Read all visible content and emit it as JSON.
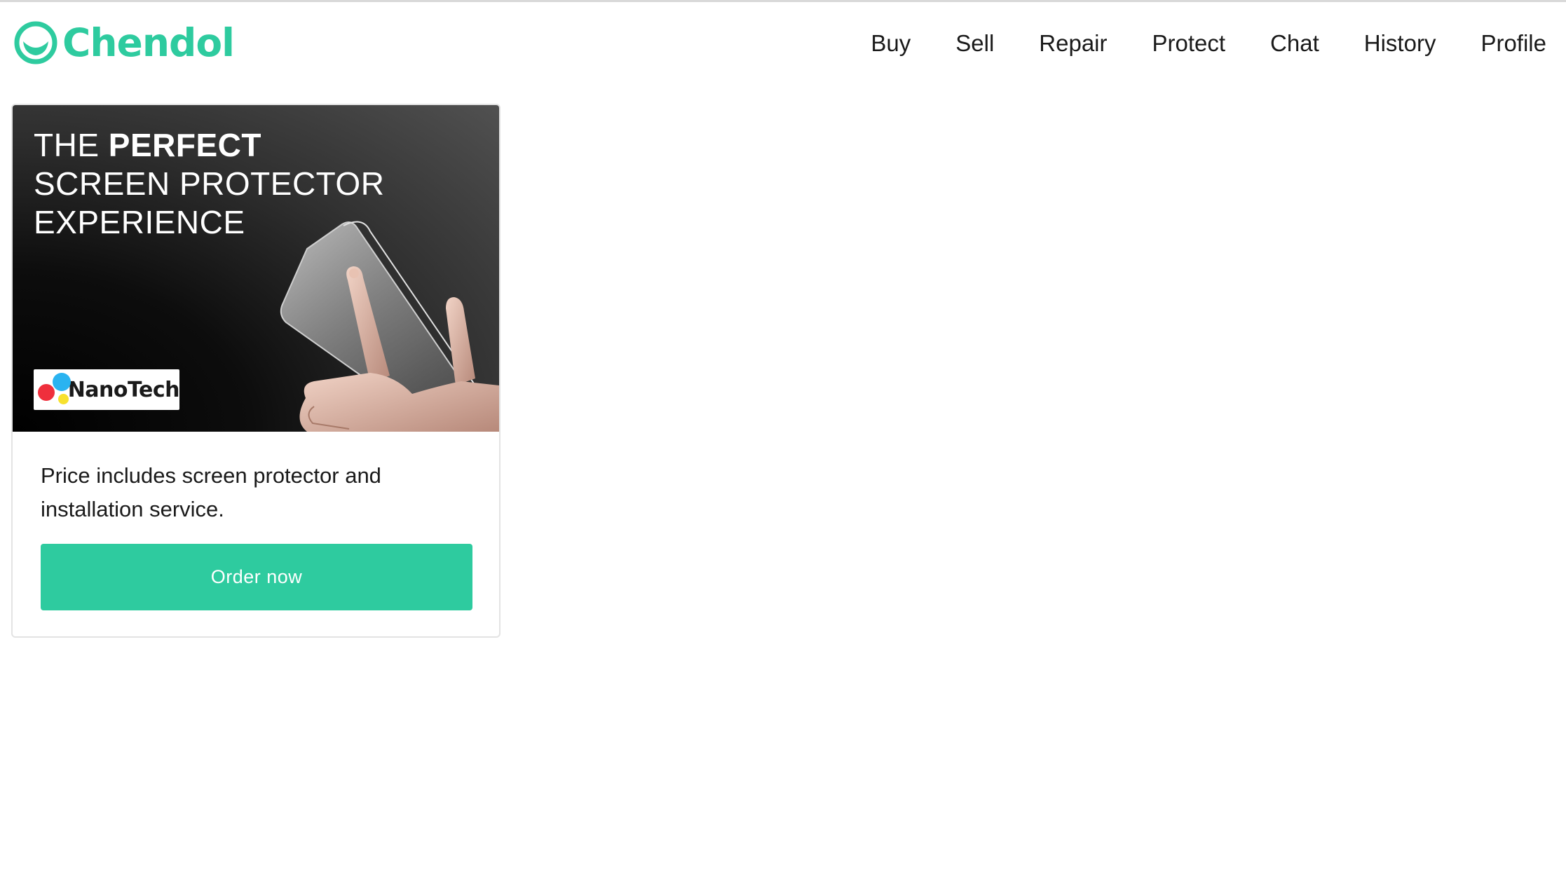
{
  "header": {
    "brand": "Chendol",
    "brand_color": "#2ecb9f",
    "logo_icon": "chendol-logo-icon",
    "nav": [
      {
        "label": "Buy"
      },
      {
        "label": "Sell"
      },
      {
        "label": "Repair"
      },
      {
        "label": "Protect"
      },
      {
        "label": "Chat"
      },
      {
        "label": "History"
      },
      {
        "label": "Profile"
      }
    ]
  },
  "product_card": {
    "banner": {
      "headline_prefix": "THE ",
      "headline_emphasis": "PERFECT",
      "headline_line2": "SCREEN PROTECTOR",
      "headline_line3": "EXPERIENCE",
      "brand_badge": "NanoTech",
      "brand_badge_colors": [
        "#ef2f3c",
        "#2ab3f0",
        "#f7e12e"
      ],
      "image": "hand-holding-screen-protector"
    },
    "description": "Price includes screen protector and installation service.",
    "cta_label": "Order now",
    "cta_color": "#2ecb9f"
  }
}
